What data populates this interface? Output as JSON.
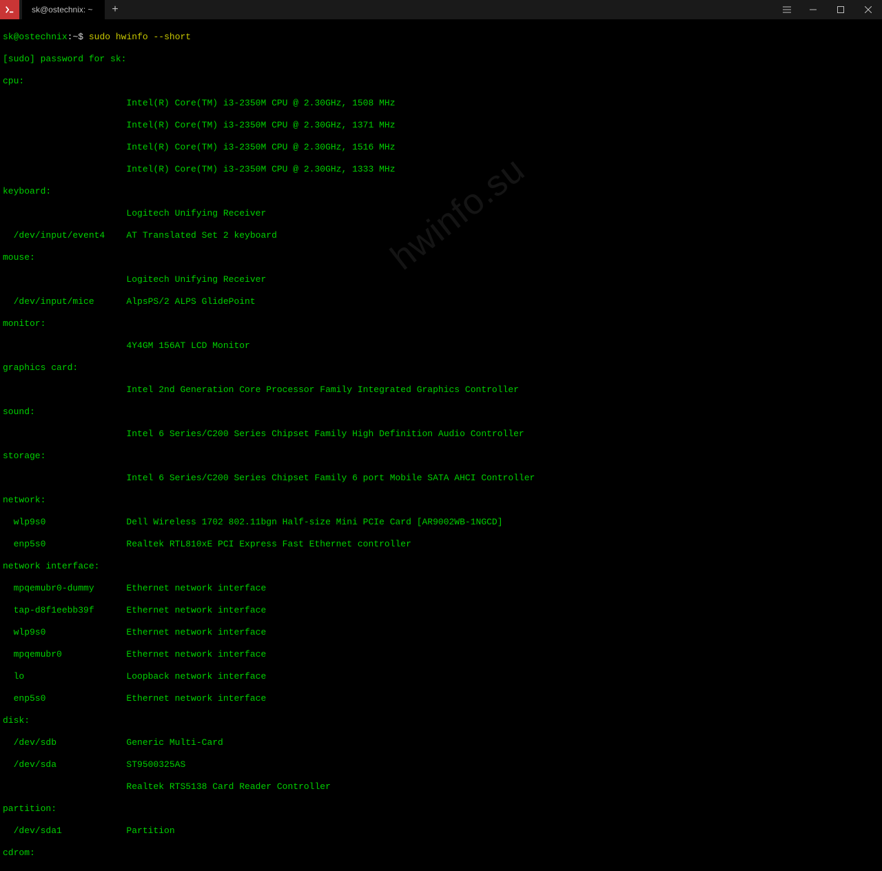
{
  "titlebar": {
    "tab_title": "sk@ostechnix: ~",
    "new_tab": "+"
  },
  "prompt": {
    "userhost": "sk@ostechnix",
    "sep": ":",
    "path": "~",
    "dollar": "$",
    "command": "sudo hwinfo --short"
  },
  "lines": {
    "sudo": "[sudo] password for sk:",
    "cpu_hdr": "cpu:",
    "cpu1": "                       Intel(R) Core(TM) i3-2350M CPU @ 2.30GHz, 1508 MHz",
    "cpu2": "                       Intel(R) Core(TM) i3-2350M CPU @ 2.30GHz, 1371 MHz",
    "cpu3": "                       Intel(R) Core(TM) i3-2350M CPU @ 2.30GHz, 1516 MHz",
    "cpu4": "                       Intel(R) Core(TM) i3-2350M CPU @ 2.30GHz, 1333 MHz",
    "kb_hdr": "keyboard:",
    "kb1": "                       Logitech Unifying Receiver",
    "kb2": "  /dev/input/event4    AT Translated Set 2 keyboard",
    "mouse_hdr": "mouse:",
    "mouse1": "                       Logitech Unifying Receiver",
    "mouse2": "  /dev/input/mice      AlpsPS/2 ALPS GlidePoint",
    "mon_hdr": "monitor:",
    "mon1": "                       4Y4GM 156AT LCD Monitor",
    "gfx_hdr": "graphics card:",
    "gfx1": "                       Intel 2nd Generation Core Processor Family Integrated Graphics Controller",
    "snd_hdr": "sound:",
    "snd1": "                       Intel 6 Series/C200 Series Chipset Family High Definition Audio Controller",
    "sto_hdr": "storage:",
    "sto1": "                       Intel 6 Series/C200 Series Chipset Family 6 port Mobile SATA AHCI Controller",
    "net_hdr": "network:",
    "net1": "  wlp9s0               Dell Wireless 1702 802.11bgn Half-size Mini PCIe Card [AR9002WB-1NGCD]",
    "net2": "  enp5s0               Realtek RTL810xE PCI Express Fast Ethernet controller",
    "nif_hdr": "network interface:",
    "nif1": "  mpqemubr0-dummy      Ethernet network interface",
    "nif2": "  tap-d8f1eebb39f      Ethernet network interface",
    "nif3": "  wlp9s0               Ethernet network interface",
    "nif4": "  mpqemubr0            Ethernet network interface",
    "nif5": "  lo                   Loopback network interface",
    "nif6": "  enp5s0               Ethernet network interface",
    "dsk_hdr": "disk:",
    "dsk1": "  /dev/sdb             Generic Multi-Card",
    "dsk2": "  /dev/sda             ST9500325AS",
    "dsk3": "                       Realtek RTS5138 Card Reader Controller",
    "part_hdr": "partition:",
    "part1": "  /dev/sda1            Partition",
    "cdrom_hdr": "cdrom:"
  },
  "watermark": "hwinfo.su"
}
